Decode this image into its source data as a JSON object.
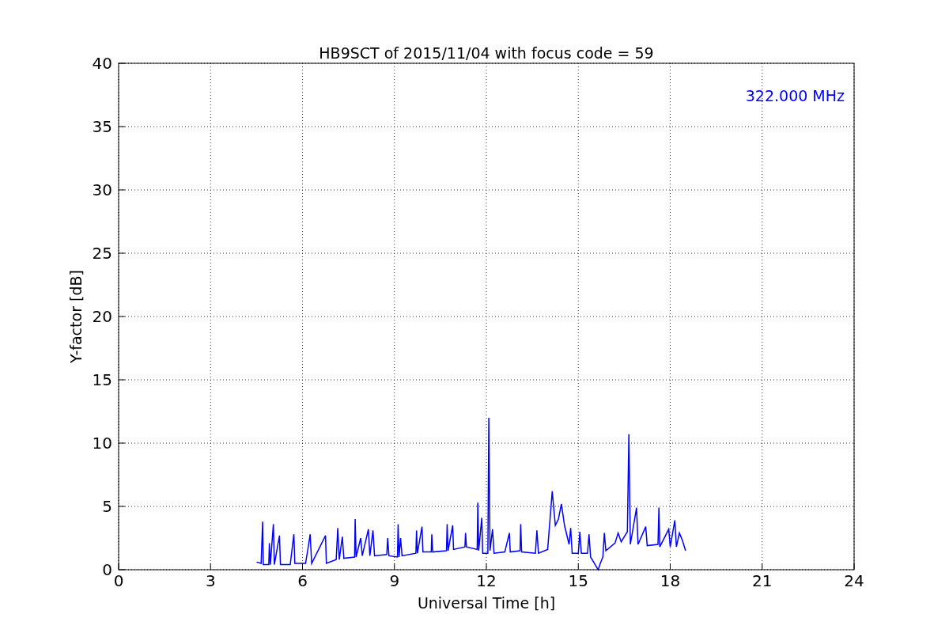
{
  "figure": {
    "chart_data": {
      "type": "line",
      "title": "HB9SCT of 2015/11/04 with focus code = 59",
      "xlabel": "Universal Time [h]",
      "ylabel": "Y-factor [dB]",
      "x": [
        4.5,
        4.65,
        4.7,
        4.72,
        4.9,
        4.92,
        4.95,
        5.05,
        5.08,
        5.25,
        5.28,
        5.6,
        5.72,
        5.75,
        6.1,
        6.2,
        6.25,
        6.3,
        6.75,
        6.78,
        7.1,
        7.15,
        7.2,
        7.3,
        7.35,
        7.7,
        7.72,
        7.75,
        7.9,
        7.95,
        8.15,
        8.2,
        8.3,
        8.35,
        8.75,
        8.78,
        8.82,
        9.1,
        9.12,
        9.15,
        9.2,
        9.25,
        9.7,
        9.72,
        9.75,
        9.9,
        9.93,
        10.2,
        10.22,
        10.25,
        10.7,
        10.72,
        10.75,
        10.9,
        10.93,
        11.3,
        11.32,
        11.35,
        11.7,
        11.72,
        11.75,
        11.85,
        11.88,
        12.05,
        12.08,
        12.12,
        12.2,
        12.25,
        12.6,
        12.75,
        12.78,
        13.1,
        13.12,
        13.15,
        13.6,
        13.65,
        13.7,
        14.0,
        14.15,
        14.25,
        14.35,
        14.45,
        14.55,
        14.7,
        14.75,
        14.8,
        15.0,
        15.05,
        15.1,
        15.3,
        15.35,
        15.4,
        15.6,
        15.65,
        15.72,
        15.8,
        15.85,
        15.9,
        16.2,
        16.3,
        16.4,
        16.6,
        16.65,
        16.7,
        16.9,
        16.95,
        17.2,
        17.25,
        17.6,
        17.63,
        17.66,
        17.95,
        18.0,
        18.15,
        18.2,
        18.3,
        18.4,
        18.5
      ],
      "series": [
        {
          "color": "#0000ff",
          "values": [
            0.6,
            0.5,
            3.8,
            0.4,
            0.4,
            2.1,
            0.4,
            3.6,
            0.4,
            2.7,
            0.4,
            0.4,
            2.8,
            0.5,
            0.5,
            2.0,
            2.8,
            0.5,
            2.7,
            0.5,
            0.8,
            3.3,
            0.8,
            2.6,
            0.9,
            1.0,
            4.0,
            1.0,
            2.5,
            1.1,
            3.2,
            1.1,
            3.1,
            1.1,
            1.2,
            2.5,
            1.1,
            1.0,
            3.6,
            1.0,
            2.5,
            1.1,
            1.3,
            3.1,
            1.3,
            3.4,
            1.4,
            1.4,
            2.8,
            1.4,
            1.5,
            3.6,
            1.5,
            3.5,
            1.6,
            1.8,
            2.9,
            1.8,
            1.6,
            5.3,
            1.5,
            4.1,
            1.3,
            1.3,
            12.0,
            1.5,
            3.2,
            1.3,
            1.4,
            2.9,
            1.4,
            1.5,
            3.6,
            1.4,
            1.3,
            3.1,
            1.3,
            1.6,
            6.2,
            3.5,
            4.0,
            5.2,
            3.5,
            2.0,
            3.3,
            1.3,
            1.3,
            3.0,
            1.3,
            1.3,
            2.8,
            1.0,
            0.2,
            0.0,
            0.5,
            1.0,
            2.9,
            1.5,
            2.1,
            2.9,
            2.2,
            3.0,
            10.7,
            2.0,
            4.9,
            2.0,
            3.4,
            1.9,
            2.0,
            4.9,
            1.8,
            3.2,
            1.8,
            3.9,
            1.8,
            2.9,
            2.3,
            1.5
          ]
        }
      ],
      "xlim": [
        0,
        24
      ],
      "ylim": [
        0,
        40
      ],
      "xticks": [
        0,
        3,
        6,
        9,
        12,
        15,
        18,
        21,
        24
      ],
      "yticks": [
        0,
        5,
        10,
        15,
        20,
        25,
        30,
        35,
        40
      ],
      "grid": true,
      "annotations": [
        {
          "text": "322.000 MHz"
        }
      ]
    }
  }
}
